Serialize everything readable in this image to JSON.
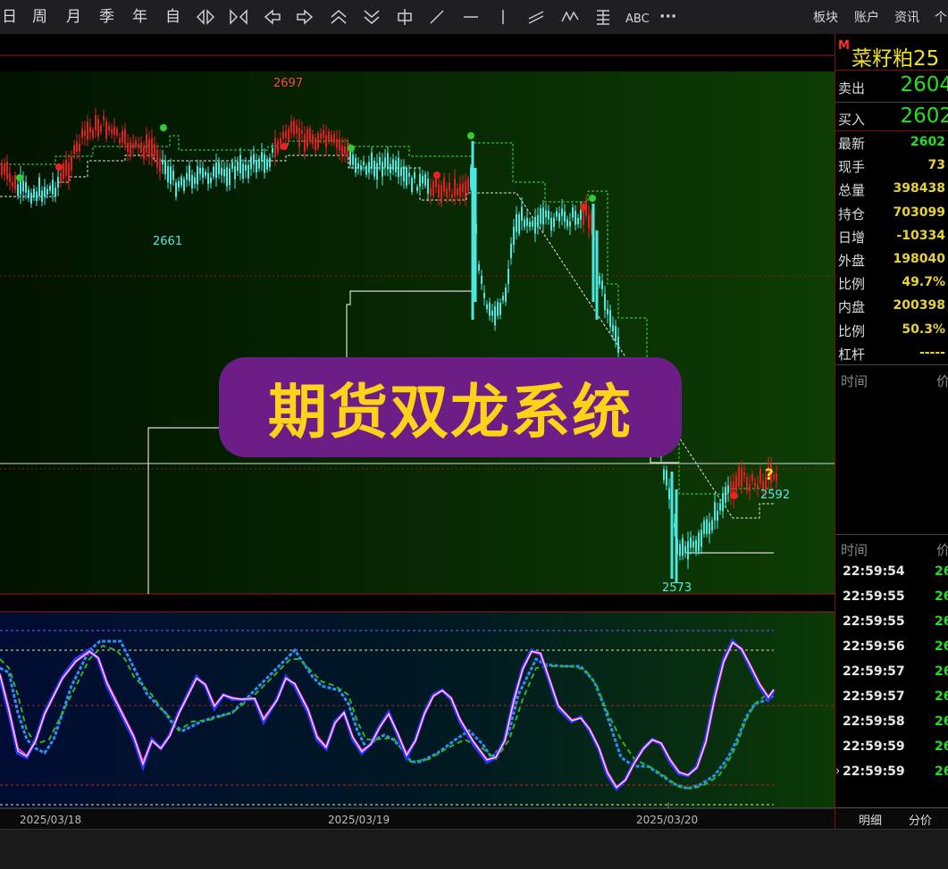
{
  "toolbar": {
    "items": [
      "日",
      "周",
      "月",
      "季",
      "年",
      "自"
    ],
    "icons": [
      "shrink-h-icon",
      "expand-h-icon",
      "arrow-left-icon",
      "arrow-right-icon",
      "chevron-up-double-icon",
      "chevron-down-double-icon",
      "cursor-bar-icon",
      "line-slant-icon",
      "line-horizontal-icon",
      "line-vertical-icon",
      "channel-icon",
      "wave-icon",
      "fib-icon"
    ],
    "abc": "ABC",
    "more": "···",
    "right": [
      "板块",
      "账户",
      "资讯",
      "个"
    ]
  },
  "chart": {
    "label_high": "2697",
    "label_mid_low": "2661",
    "label_low": "2573",
    "label_last": "2592",
    "question": "?",
    "dates": [
      "2025/03/18",
      "2025/03/19",
      "2025/03/20"
    ]
  },
  "overlay": {
    "text": "期货双龙系统"
  },
  "quote": {
    "marker": "M",
    "title": "菜籽粕25",
    "sell_label": "卖出",
    "sell_value": "2604",
    "buy_label": "买入",
    "buy_value": "2602",
    "rows": [
      {
        "label": "最新",
        "value": "2602",
        "color": "#22e022"
      },
      {
        "label": "现手",
        "value": "73",
        "color": "#e8d23a"
      },
      {
        "label": "总量",
        "value": "398438",
        "color": "#e8d23a"
      },
      {
        "label": "持仓",
        "value": "703099",
        "color": "#e8d23a"
      },
      {
        "label": "日增",
        "value": "-10334",
        "color": "#e8d23a"
      },
      {
        "label": "外盘",
        "value": "198040",
        "color": "#e8d23a"
      },
      {
        "label": "比例",
        "value": "49.7%",
        "color": "#e8d23a"
      },
      {
        "label": "内盘",
        "value": "200398",
        "color": "#e8d23a"
      },
      {
        "label": "比例",
        "value": "50.3%",
        "color": "#e8d23a"
      },
      {
        "label": "杠杆",
        "value": "-----",
        "color": "#e8d23a"
      }
    ],
    "time_header": "时间",
    "price_header": "价",
    "ticks_header_time": "时间",
    "ticks_header_price": "价",
    "ticks": [
      {
        "time": "22:59:54",
        "price": "26"
      },
      {
        "time": "22:59:55",
        "price": "26"
      },
      {
        "time": "22:59:55",
        "price": "26"
      },
      {
        "time": "22:59:56",
        "price": "26"
      },
      {
        "time": "22:59:57",
        "price": "26"
      },
      {
        "time": "22:59:57",
        "price": "26"
      },
      {
        "time": "22:59:58",
        "price": "26"
      },
      {
        "time": "22:59:59",
        "price": "26"
      },
      {
        "time": "22:59:59",
        "price": "26"
      }
    ],
    "tab_detail": "明细",
    "tab_price": "分价"
  }
}
